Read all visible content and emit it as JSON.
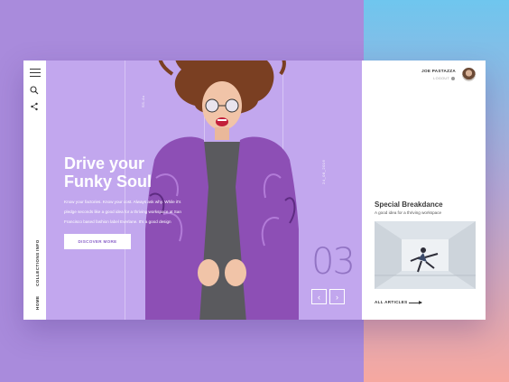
{
  "user": {
    "name": "JOE PASTAZZA",
    "logout": "LOGOUT"
  },
  "sidebar": {
    "links": [
      "INFO",
      "COLLECTIONS",
      "HOME"
    ]
  },
  "hero": {
    "headline_line1": "Drive your",
    "headline_line2": "Funky Soul",
    "description": "Know your factories. Know your cost. Always ask why. While it's pledge seconds like a good idea for a thriving workspace at San Francisco based fashion label Everlane. It's a good design",
    "discover_label": "DISCOVER MORE",
    "slide_number": "03",
    "vertical_label_1": "SS-4x",
    "vertical_label_2": "24_08_2016"
  },
  "article": {
    "title": "Special Breakdance",
    "subtitle": "A good idea for a thriving workspace",
    "all_articles_label": "ALL ARTICLES"
  },
  "colors": {
    "hero_bg": "#c2a7ee",
    "accent": "#8a62c8",
    "page_bg": "#a98bdc"
  },
  "icons": [
    "menu-icon",
    "search-icon",
    "share-icon",
    "chevron-left-icon",
    "chevron-right-icon",
    "arrow-right-icon"
  ]
}
